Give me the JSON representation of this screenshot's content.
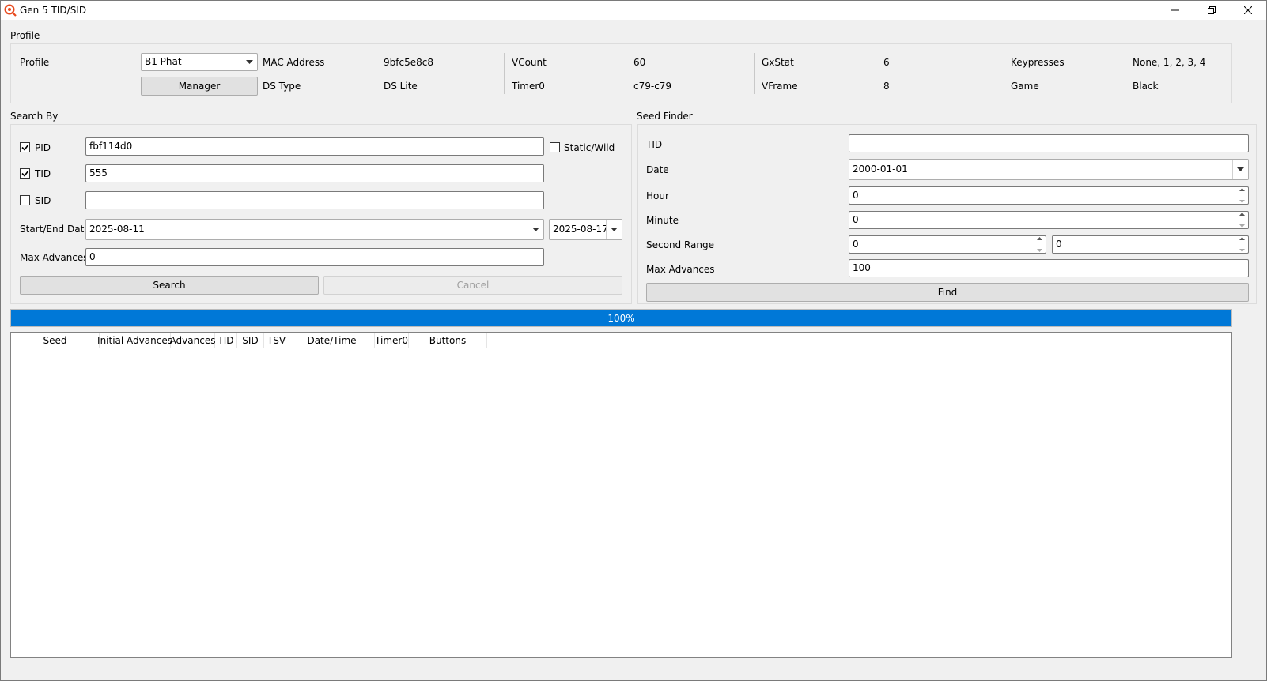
{
  "window": {
    "title": "Gen 5 TID/SID",
    "controls": {
      "minimize_icon": "minimize-icon",
      "restore_icon": "restore-icon",
      "close_icon": "close-icon"
    }
  },
  "profile": {
    "group_title": "Profile",
    "profile_label": "Profile",
    "profile_value": "B1 Phat",
    "manager_button": "Manager",
    "mac_label": "MAC Address",
    "mac_value": "9bfc5e8c8",
    "dstype_label": "DS Type",
    "dstype_value": "DS Lite",
    "vcount_label": "VCount",
    "vcount_value": "60",
    "timer0_label": "Timer0",
    "timer0_value": "c79-c79",
    "gxstat_label": "GxStat",
    "gxstat_value": "6",
    "vframe_label": "VFrame",
    "vframe_value": "8",
    "keypresses_label": "Keypresses",
    "keypresses_value": "None, 1, 2, 3, 4",
    "game_label": "Game",
    "game_value": "Black"
  },
  "search_by": {
    "group_title": "Search By",
    "pid_label": "PID",
    "pid_checked": true,
    "pid_value": "fbf114d0",
    "static_wild_label": "Static/Wild",
    "static_wild_checked": false,
    "tid_label": "TID",
    "tid_checked": true,
    "tid_value": "555",
    "sid_label": "SID",
    "sid_checked": false,
    "sid_value": "",
    "date_label": "Start/End Date",
    "start_date": "2025-08-11",
    "end_date": "2025-08-17",
    "max_adv_label": "Max Advances",
    "max_adv_value": "0",
    "search_button": "Search",
    "cancel_button": "Cancel"
  },
  "seed_finder": {
    "group_title": "Seed Finder",
    "tid_label": "TID",
    "tid_value": "",
    "date_label": "Date",
    "date_value": "2000-01-01",
    "hour_label": "Hour",
    "hour_value": "0",
    "minute_label": "Minute",
    "minute_value": "0",
    "second_label": "Second Range",
    "second_min": "0",
    "second_max": "0",
    "max_adv_label": "Max Advances",
    "max_adv_value": "100",
    "find_button": "Find"
  },
  "progress": {
    "text": "100%",
    "value": 100
  },
  "results_table": {
    "columns": [
      "Seed",
      "Initial Advances",
      "Advances",
      "TID",
      "SID",
      "TSV",
      "Date/Time",
      "Timer0",
      "Buttons"
    ],
    "rows": []
  },
  "colors": {
    "accent": "#0078d7",
    "window_bg": "#f0f0f0"
  }
}
